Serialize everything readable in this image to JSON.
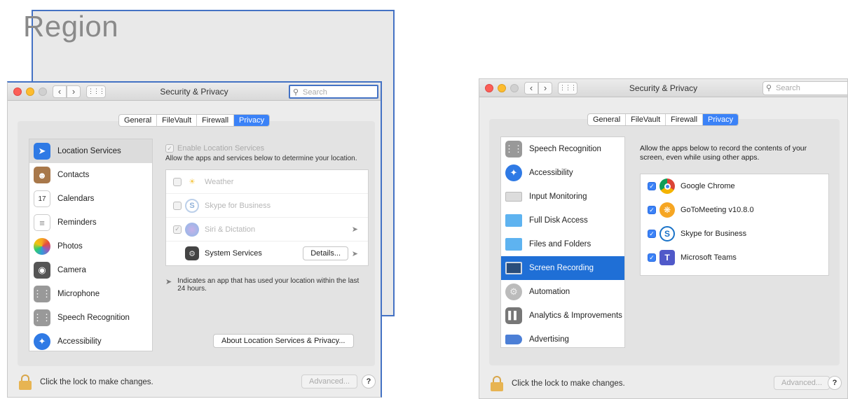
{
  "background_window": {
    "title": "Region"
  },
  "left_window": {
    "title": "Security & Privacy",
    "search_placeholder": "Search",
    "tabs": [
      {
        "label": "General",
        "active": false
      },
      {
        "label": "FileVault",
        "active": false
      },
      {
        "label": "Firewall",
        "active": false
      },
      {
        "label": "Privacy",
        "active": true
      }
    ],
    "sidebar": [
      {
        "label": "Location Services",
        "icon": "location-arrow-icon",
        "selected": false
      },
      {
        "label": "Contacts",
        "icon": "contacts-icon",
        "selected": false
      },
      {
        "label": "Calendars",
        "icon": "calendar-icon",
        "selected": false
      },
      {
        "label": "Reminders",
        "icon": "reminders-icon",
        "selected": false
      },
      {
        "label": "Photos",
        "icon": "photos-icon",
        "selected": false
      },
      {
        "label": "Camera",
        "icon": "camera-icon",
        "selected": false
      },
      {
        "label": "Microphone",
        "icon": "microphone-icon",
        "selected": false
      },
      {
        "label": "Speech Recognition",
        "icon": "speech-icon",
        "selected": false
      },
      {
        "label": "Accessibility",
        "icon": "accessibility-icon",
        "selected": false
      }
    ],
    "enable_location_label": "Enable Location Services",
    "location_description": "Allow the apps and services below to determine your location.",
    "apps": [
      {
        "name": "Weather",
        "icon": "weather-icon"
      },
      {
        "name": "Skype for Business",
        "icon": "skype-icon"
      },
      {
        "name": "Siri & Dictation",
        "icon": "siri-icon"
      },
      {
        "name": "System Services",
        "icon": "gear-icon"
      }
    ],
    "details_label": "Details...",
    "legend_text": "Indicates an app that has used your location within the last 24 hours.",
    "about_label": "About Location Services & Privacy...",
    "lock_text": "Click the lock to make changes.",
    "advanced_label": "Advanced...",
    "help_label": "?"
  },
  "right_window": {
    "title": "Security & Privacy",
    "search_placeholder": "Search",
    "tabs": [
      {
        "label": "General",
        "active": false
      },
      {
        "label": "FileVault",
        "active": false
      },
      {
        "label": "Firewall",
        "active": false
      },
      {
        "label": "Privacy",
        "active": true
      }
    ],
    "sidebar": [
      {
        "label": "Speech Recognition",
        "icon": "speech-icon"
      },
      {
        "label": "Accessibility",
        "icon": "accessibility-icon"
      },
      {
        "label": "Input Monitoring",
        "icon": "keyboard-icon"
      },
      {
        "label": "Full Disk Access",
        "icon": "folder-icon"
      },
      {
        "label": "Files and Folders",
        "icon": "folder-icon"
      },
      {
        "label": "Screen Recording",
        "icon": "screen-icon"
      },
      {
        "label": "Automation",
        "icon": "automation-gear-icon"
      },
      {
        "label": "Analytics & Improvements",
        "icon": "analytics-icon"
      },
      {
        "label": "Advertising",
        "icon": "megaphone-icon"
      }
    ],
    "description": "Allow the apps below to record the contents of your screen, even while using other apps.",
    "apps": [
      {
        "name": "Google Chrome",
        "icon": "chrome-icon"
      },
      {
        "name": "GoToMeeting v10.8.0",
        "icon": "gotomeeting-icon"
      },
      {
        "name": "Skype for Business",
        "icon": "skype-icon"
      },
      {
        "name": "Microsoft Teams",
        "icon": "teams-icon"
      }
    ],
    "lock_text": "Click the lock to make changes.",
    "advanced_label": "Advanced...",
    "help_label": "?"
  }
}
